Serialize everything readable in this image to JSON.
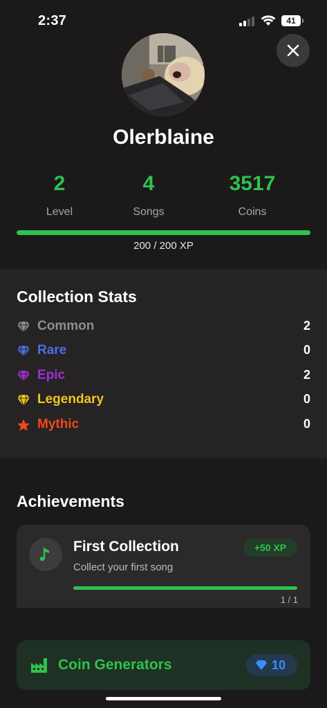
{
  "status_bar": {
    "time": "2:37",
    "battery": "41"
  },
  "profile": {
    "username": "Olerblaine"
  },
  "stats": [
    {
      "value": "2",
      "label": "Level"
    },
    {
      "value": "4",
      "label": "Songs"
    },
    {
      "value": "3517",
      "label": "Coins"
    }
  ],
  "xp": {
    "text": "200 / 200 XP",
    "progress": 1.0
  },
  "collection": {
    "title": "Collection Stats",
    "rarities": [
      {
        "label": "Common",
        "count": "2",
        "color": "#8e8e8e",
        "icon": "diamond-icon"
      },
      {
        "label": "Rare",
        "count": "0",
        "color": "#4d6ee6",
        "icon": "diamond-icon"
      },
      {
        "label": "Epic",
        "count": "2",
        "color": "#a12fd6",
        "icon": "diamond-icon"
      },
      {
        "label": "Legendary",
        "count": "0",
        "color": "#f0c61f",
        "icon": "diamond-icon"
      },
      {
        "label": "Mythic",
        "count": "0",
        "color": "#f0471f",
        "icon": "star-icon"
      }
    ]
  },
  "achievements": {
    "title": "Achievements",
    "items": [
      {
        "title": "First Collection",
        "description": "Collect your first song",
        "xp_badge": "+50 XP",
        "progress_text": "1 / 1",
        "progress": 1.0,
        "icon": "music-note-icon"
      }
    ]
  },
  "coin_generators": {
    "label": "Coin Generators",
    "gems": "10",
    "icon": "factory-icon"
  },
  "colors": {
    "accent_green": "#2fc24e",
    "background": "#1b1919",
    "gem_blue": "#3b8cff"
  }
}
